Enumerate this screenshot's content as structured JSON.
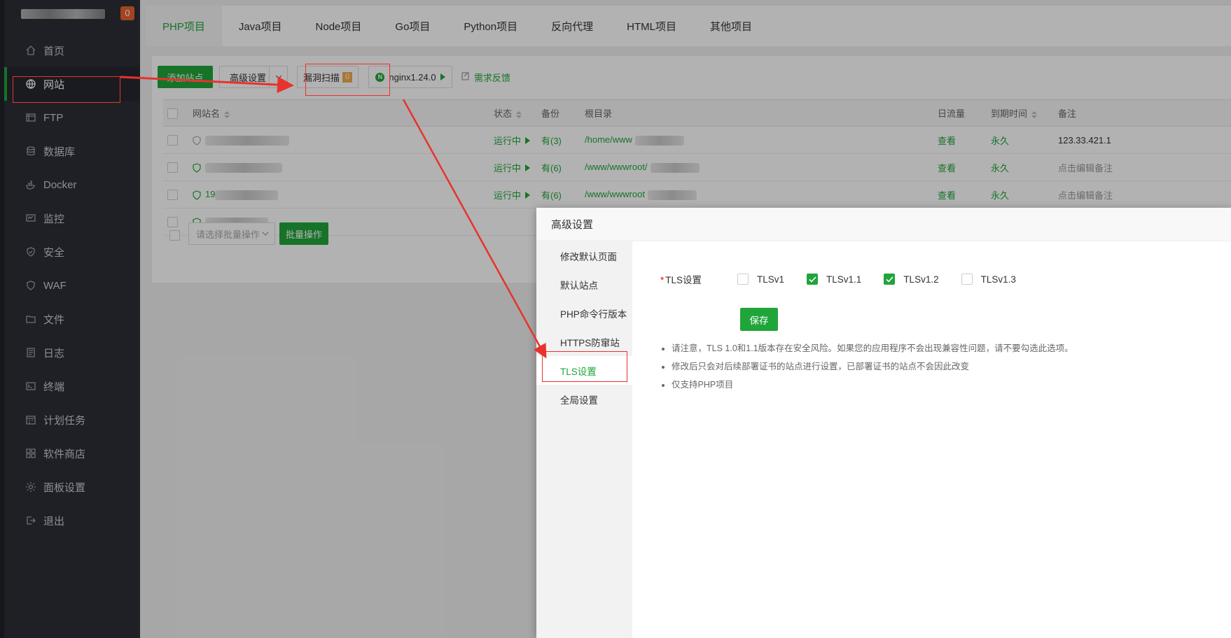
{
  "sidebar": {
    "badge": "0",
    "items": [
      {
        "label": "首页",
        "icon": "home-icon"
      },
      {
        "label": "网站",
        "icon": "globe-icon"
      },
      {
        "label": "FTP",
        "icon": "ftp-icon"
      },
      {
        "label": "数据库",
        "icon": "database-icon"
      },
      {
        "label": "Docker",
        "icon": "docker-icon"
      },
      {
        "label": "监控",
        "icon": "monitor-icon"
      },
      {
        "label": "安全",
        "icon": "shield-icon"
      },
      {
        "label": "WAF",
        "icon": "waf-icon"
      },
      {
        "label": "文件",
        "icon": "folder-icon"
      },
      {
        "label": "日志",
        "icon": "log-icon"
      },
      {
        "label": "终端",
        "icon": "terminal-icon"
      },
      {
        "label": "计划任务",
        "icon": "calendar-icon"
      },
      {
        "label": "软件商店",
        "icon": "grid-icon"
      },
      {
        "label": "面板设置",
        "icon": "gear-icon"
      },
      {
        "label": "退出",
        "icon": "logout-icon"
      }
    ]
  },
  "tabs": [
    "PHP项目",
    "Java项目",
    "Node项目",
    "Go项目",
    "Python项目",
    "反向代理",
    "HTML项目",
    "其他项目"
  ],
  "toolbar": {
    "add_site": "添加站点",
    "advanced": "高级设置",
    "scan": "漏洞扫描",
    "scan_count": "0",
    "nginx": "nginx1.24.0",
    "feedback": "需求反馈"
  },
  "table": {
    "headers": {
      "name": "网站名",
      "status": "状态",
      "backup": "备份",
      "root": "根目录",
      "traffic": "日流量",
      "expire": "到期时间",
      "note": "备注"
    },
    "rows": [
      {
        "status": "运行中",
        "backup": "有(3)",
        "root": "/home/www",
        "traffic": "查看",
        "expire": "永久",
        "note": "123.33.421.1"
      },
      {
        "status": "运行中",
        "backup": "有(6)",
        "root": "/www/wwwroot/",
        "traffic": "查看",
        "expire": "永久",
        "note": "点击编辑备注"
      },
      {
        "status": "运行中",
        "backup": "有(6)",
        "root": "/www/wwwroot",
        "traffic": "查看",
        "expire": "永久",
        "note": "点击编辑备注",
        "name_prefix": "19"
      },
      {
        "status": "",
        "backup": "",
        "root": "",
        "traffic": "",
        "expire": "",
        "note": ""
      }
    ],
    "batch_placeholder": "请选择批量操作",
    "batch_button": "批量操作"
  },
  "modal": {
    "title": "高级设置",
    "menu": [
      "修改默认页面",
      "默认站点",
      "PHP命令行版本",
      "HTTPS防窜站",
      "TLS设置",
      "全局设置"
    ],
    "active_menu": "TLS设置",
    "tls_label": "TLS设置",
    "options": [
      {
        "label": "TLSv1",
        "checked": false
      },
      {
        "label": "TLSv1.1",
        "checked": true
      },
      {
        "label": "TLSv1.2",
        "checked": true
      },
      {
        "label": "TLSv1.3",
        "checked": false
      }
    ],
    "save": "保存",
    "notes": [
      "请注意，TLS 1.0和1.1版本存在安全风险。如果您的应用程序不会出现兼容性问题，请不要勾选此选项。",
      "修改后只会对后续部署证书的站点进行设置，已部署证书的站点不会因此改变",
      "仅支持PHP项目"
    ]
  },
  "colors": {
    "accent": "#20a53a",
    "sidebar": "#2b2f36",
    "annotation": "#e8322d"
  }
}
